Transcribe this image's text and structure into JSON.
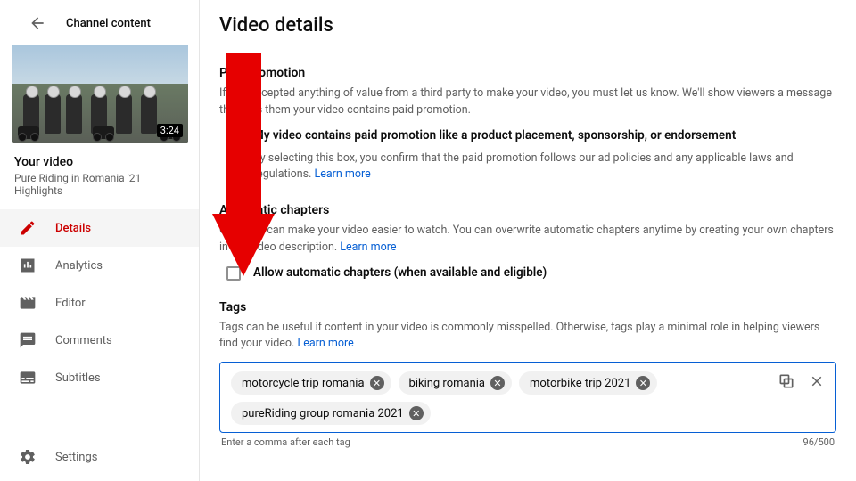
{
  "header": {
    "channel_content": "Channel content",
    "page_title": "Video details"
  },
  "thumb": {
    "duration": "3:24"
  },
  "your_video": {
    "label": "Your video",
    "title": "Pure Riding in Romania '21 Highlights"
  },
  "nav": {
    "details": "Details",
    "analytics": "Analytics",
    "editor": "Editor",
    "comments": "Comments",
    "subtitles": "Subtitles",
    "settings": "Settings"
  },
  "paid_promo": {
    "heading": "Paid promotion",
    "desc": "If you accepted anything of value from a third party to make your video, you must let us know. We'll show viewers a message that tells them your video contains paid promotion.",
    "check_label": "My video contains paid promotion like a product placement, sponsorship, or endorsement",
    "sub": "By selecting this box, you confirm that the paid promotion follows our ad policies and any applicable laws and regulations. "
  },
  "auto_chapters": {
    "heading": "Automatic chapters",
    "desc_a": "Chapters can make your video easier to watch. You can overwrite automatic chapters anytime by creating your own chapters in the video description. ",
    "check_label": "Allow automatic chapters (when available and eligible)"
  },
  "tags": {
    "heading": "Tags",
    "desc": "Tags can be useful if content in your video is commonly misspelled. Otherwise, tags play a minimal role in helping viewers find your video. ",
    "items": [
      "motorcycle trip romania",
      "biking romania",
      "motorbike trip 2021",
      "pureRiding group romania 2021"
    ],
    "hint": "Enter a comma after each tag",
    "counter": "96/500"
  },
  "common": {
    "learn_more": "Learn more"
  }
}
